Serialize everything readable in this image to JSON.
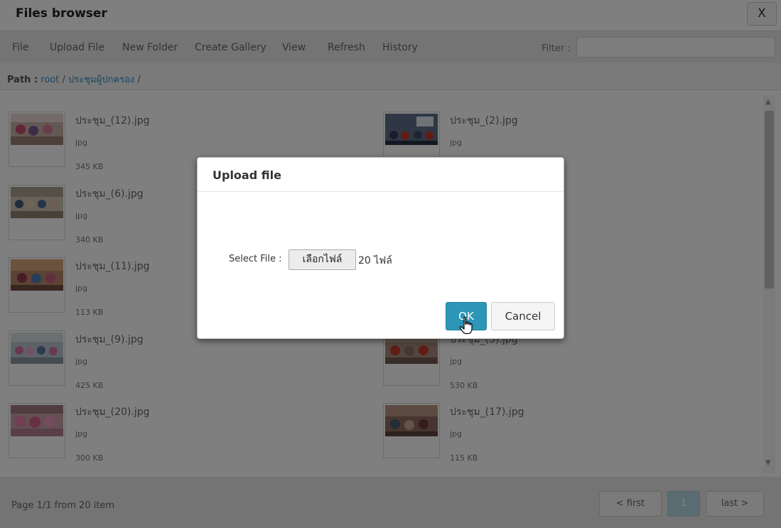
{
  "window": {
    "title": "Files browser",
    "close_label": "X"
  },
  "menu": [
    {
      "label": "File"
    },
    {
      "label": "Upload File"
    },
    {
      "label": "New Folder"
    },
    {
      "label": "Create Gallery"
    },
    {
      "label": "View"
    },
    {
      "label": "Refresh"
    },
    {
      "label": "History"
    }
  ],
  "filter": {
    "label": "Filter :",
    "value": "",
    "placeholder": ""
  },
  "path": {
    "label": "Path :",
    "root": "root",
    "sep": "/",
    "folder": "ประชุมผู้ปกครอง",
    "trailing": "/"
  },
  "files": [
    {
      "name": "ประชุม_(12).jpg",
      "type": "jpg",
      "size": "345 KB"
    },
    {
      "name": "ประชุม_(2).jpg",
      "type": "jpg",
      "size": ""
    },
    {
      "name": "ประชุม_(6).jpg",
      "type": "jpg",
      "size": "340 KB"
    },
    {
      "name": "ประชุม_(11).jpg",
      "type": "jpg",
      "size": "113 KB"
    },
    {
      "name": "ประชุม_(9).jpg",
      "type": "jpg",
      "size": "425 KB"
    },
    {
      "name": "ประชุม_(5).jpg",
      "type": "jpg",
      "size": "530 KB"
    },
    {
      "name": "ประชุม_(20).jpg",
      "type": "jpg",
      "size": "300 KB"
    },
    {
      "name": "ประชุม_(17).jpg",
      "type": "jpg",
      "size": "115 KB"
    }
  ],
  "footer": {
    "page_info": "Page 1/1 from 20 item",
    "first": "< first",
    "current": "1",
    "last": "last >"
  },
  "modal": {
    "title": "Upload file",
    "select_label": "Select File :",
    "choose_button": "เลือกไฟล์",
    "file_count": "20 ไฟล์",
    "ok": "OK",
    "cancel": "Cancel"
  },
  "colors": {
    "accent": "#2d96b8",
    "link": "#3a8dc4"
  }
}
